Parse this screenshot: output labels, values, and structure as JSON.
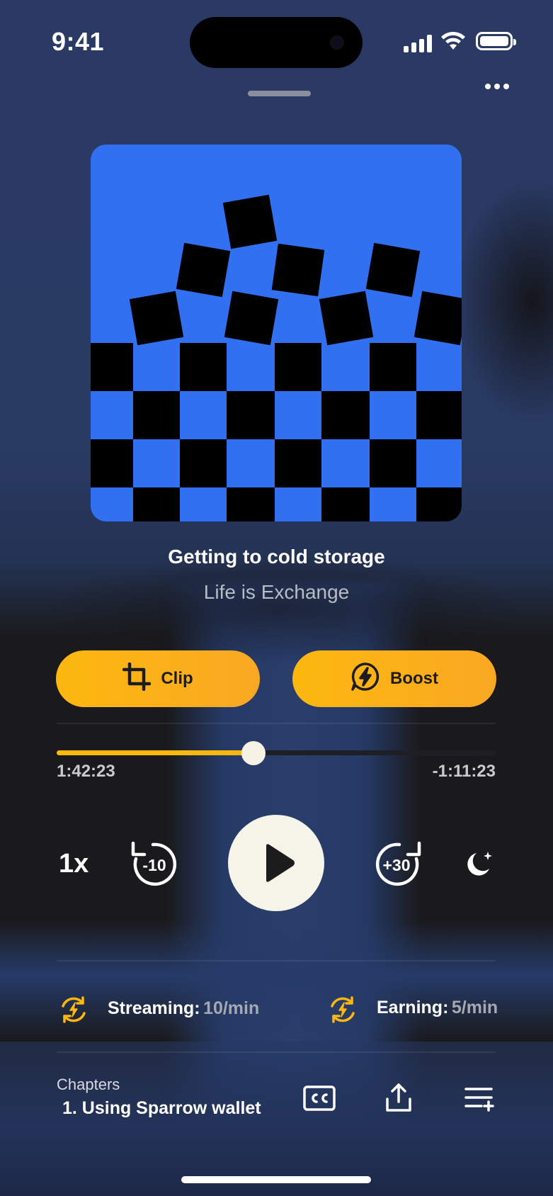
{
  "status_bar": {
    "time": "9:41"
  },
  "episode": {
    "title": "Getting to cold storage",
    "podcast": "Life is Exchange"
  },
  "actions": {
    "clip_label": "Clip",
    "boost_label": "Boost"
  },
  "progress": {
    "elapsed": "1:42:23",
    "remaining": "-1:11:23",
    "fraction": 0.449
  },
  "controls": {
    "speed": "1x",
    "rewind_label": "-10",
    "forward_label": "+30"
  },
  "stats": {
    "streaming_label": "Streaming:",
    "streaming_value": "10/min",
    "earning_label": "Earning:",
    "earning_value": "5/min"
  },
  "chapters": {
    "label": "Chapters",
    "current": "1. Using Sparrow wallet"
  },
  "colors": {
    "accent": "#fdb80f",
    "artwork_blue": "#3171f1",
    "background": "#1a1a1c",
    "background_blue": "#2a3a64"
  }
}
